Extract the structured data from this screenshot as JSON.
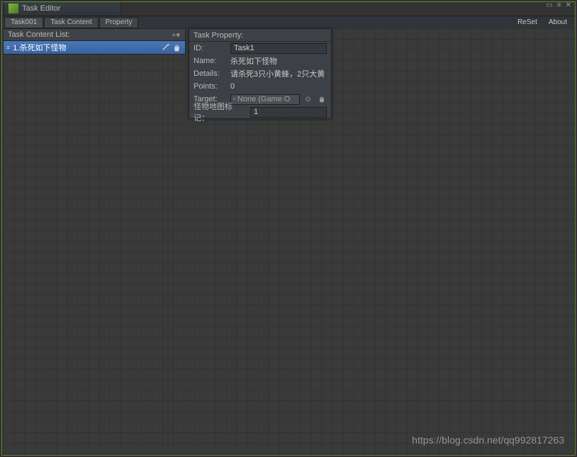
{
  "window": {
    "title": "Task Editor"
  },
  "tabs": {
    "task": "Task001",
    "content": "Task Content",
    "property": "Property"
  },
  "right_links": {
    "reset": "ReSet",
    "about": "About"
  },
  "list": {
    "header": "Task Content List:",
    "items": [
      {
        "label": "1.杀死如下怪物"
      }
    ]
  },
  "property": {
    "header": "Task Property:",
    "id_label": "ID:",
    "id_value": "Task1",
    "name_label": "Name:",
    "name_value": "杀死如下怪物",
    "details_label": "Details:",
    "details_value": "请杀死3只小黄蜂，2只大黄",
    "points_label": "Points:",
    "points_value": "0",
    "target_label": "Target:",
    "target_value": "None (Game O",
    "marker_label": "怪物地图标记：",
    "marker_value": "1"
  },
  "watermark": "https://blog.csdn.net/qq992817263"
}
